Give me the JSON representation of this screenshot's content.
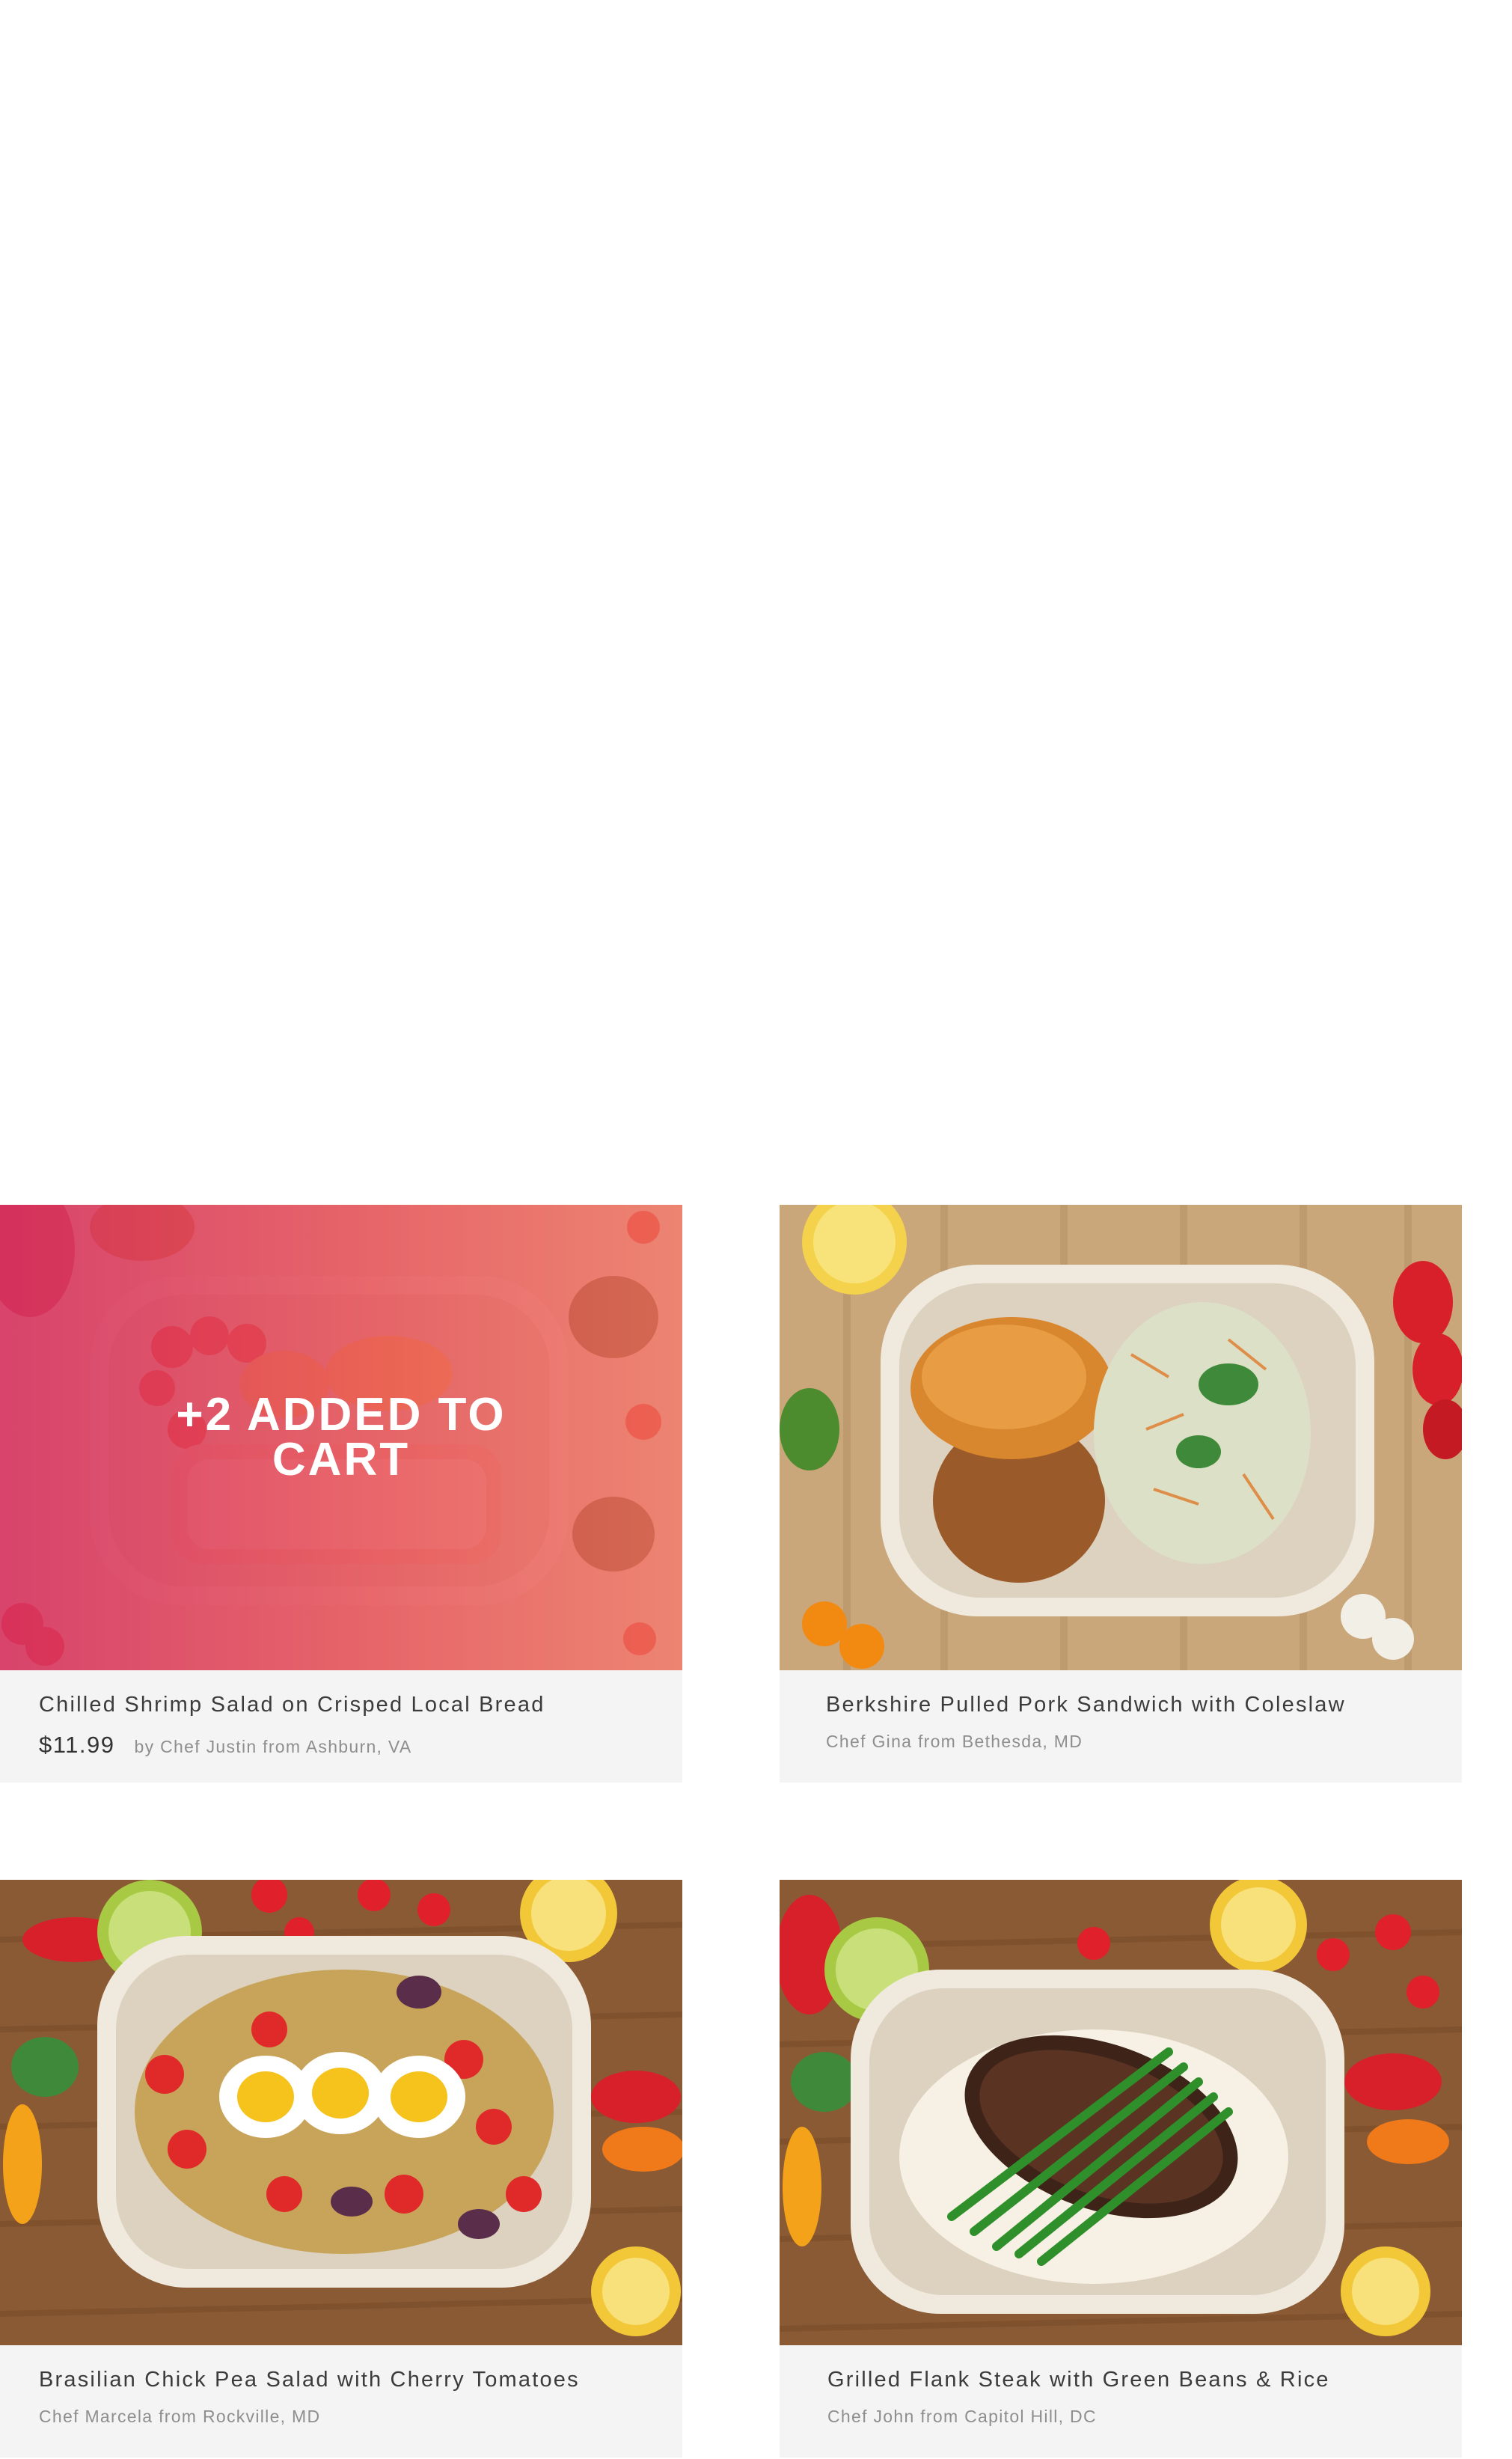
{
  "cards": [
    {
      "title": "Chilled Shrimp Salad on Crisped Local Bread",
      "price": "$11.99",
      "chef": "by Chef Justin from Ashburn, VA",
      "overlay": "+2 ADDED TO CART"
    },
    {
      "title": "Berkshire Pulled Pork Sandwich with Coleslaw",
      "chef": "Chef Gina from Bethesda, MD"
    },
    {
      "title": "Brasilian Chick Pea Salad with Cherry Tomatoes",
      "chef": "Chef Marcela from Rockville, MD"
    },
    {
      "title": "Grilled Flank Steak with Green Beans & Rice",
      "chef": "Chef John from Capitol Hill, DC"
    }
  ],
  "colors": {
    "overlay_start": "#d63060",
    "overlay_end": "#f06e5c",
    "card_bg": "#f4f4f4"
  }
}
